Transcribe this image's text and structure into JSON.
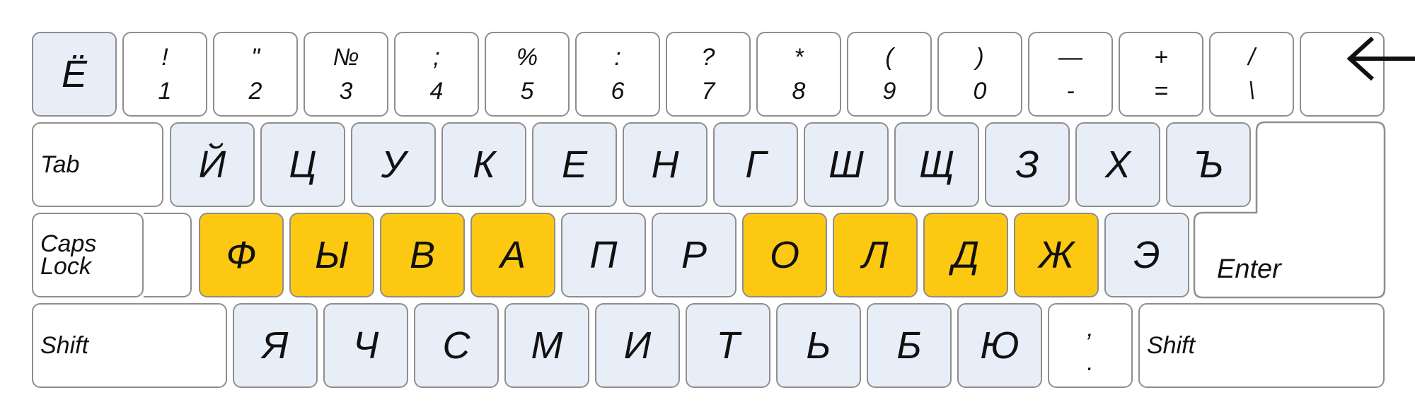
{
  "colors": {
    "key_default": "#ffffff",
    "key_alpha": "#e8eef8",
    "key_home_row": "#fdc811",
    "border": "#8e8e8e"
  },
  "number_row": [
    {
      "label": "Ё"
    },
    {
      "top": "!",
      "bottom": "1"
    },
    {
      "top": "\"",
      "bottom": "2"
    },
    {
      "top": "№",
      "bottom": "3"
    },
    {
      "top": ";",
      "bottom": "4"
    },
    {
      "top": "%",
      "bottom": "5"
    },
    {
      "top": ":",
      "bottom": "6"
    },
    {
      "top": "?",
      "bottom": "7"
    },
    {
      "top": "*",
      "bottom": "8"
    },
    {
      "top": "(",
      "bottom": "9"
    },
    {
      "top": ")",
      "bottom": "0"
    },
    {
      "top": "—",
      "bottom": "-"
    },
    {
      "top": "+",
      "bottom": "="
    },
    {
      "top": "/",
      "bottom": "\\"
    }
  ],
  "backspace": {
    "icon": "arrow-left-icon"
  },
  "tab_row": {
    "tab_label": "Tab",
    "keys": [
      "Й",
      "Ц",
      "У",
      "К",
      "Е",
      "Н",
      "Г",
      "Ш",
      "Щ",
      "З",
      "Х",
      "Ъ"
    ]
  },
  "home_row": {
    "caps_label": "Caps\nLock",
    "enter_label": "Enter",
    "keys": [
      "Ф",
      "Ы",
      "В",
      "А",
      "П",
      "Р",
      "О",
      "Л",
      "Д",
      "Ж",
      "Э"
    ],
    "highlighted": [
      "Ф",
      "Ы",
      "В",
      "А",
      "О",
      "Л",
      "Д",
      "Ж"
    ]
  },
  "shift_row": {
    "left_shift_label": "Shift",
    "right_shift_label": "Shift",
    "keys": [
      "Я",
      "Ч",
      "С",
      "М",
      "И",
      "Т",
      "Ь",
      "Б",
      "Ю"
    ],
    "punct": {
      "top": ",",
      "bottom": "."
    }
  }
}
